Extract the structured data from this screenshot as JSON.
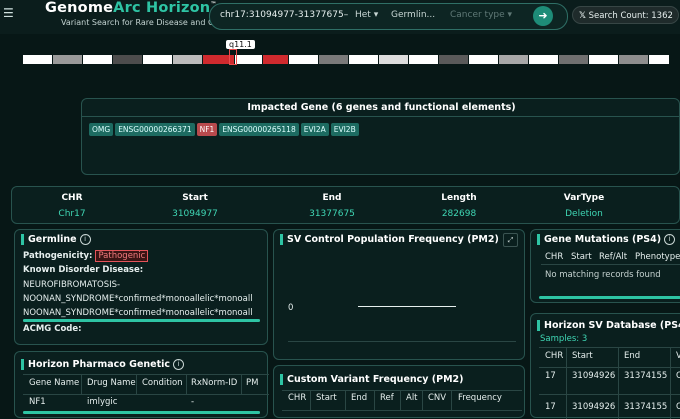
{
  "header": {
    "brand_prefix": "Genome",
    "brand_accent": "Arc Horizon",
    "brand_tm": "™",
    "subtitle": "Variant Search for Rare Disease and Cancer",
    "search_value": "chr17:31094977-31377675",
    "search_ellipsis": "–",
    "zygosity": "Het",
    "origin": "Germlin...",
    "cancer_placeholder": "Cancer type",
    "search_count": "Search Count: 1362",
    "accent_color": "#2ec4a4"
  },
  "ideogram": {
    "band_label": "q11.1"
  },
  "impacted": {
    "title": "Impacted Gene (6 genes and functional elements)",
    "chips": [
      {
        "text": "OMG",
        "type": "normal"
      },
      {
        "text": "ENSG00000266371",
        "type": "normal"
      },
      {
        "text": "NF1",
        "type": "red"
      },
      {
        "text": "ENSG00000265118",
        "type": "normal"
      },
      {
        "text": "EVI2A",
        "type": "normal"
      },
      {
        "text": "EVI2B",
        "type": "normal"
      }
    ]
  },
  "summary": {
    "chr_label": "CHR",
    "chr_value": "Chr17",
    "start_label": "Start",
    "start_value": "31094977",
    "end_label": "End",
    "end_value": "31377675",
    "length_label": "Length",
    "length_value": "282698",
    "vartype_label": "VarType",
    "vartype_value": "Deletion"
  },
  "germline": {
    "title": "Germline",
    "pathogenicity_label": "Pathogenicity:",
    "pathogenicity_value": "Pathogenic",
    "disorder_label": "Known Disorder Disease:",
    "disorder_line1": "NEUROFIBROMATOSIS-",
    "disorder_line2": "NOONAN_SYNDROME*confirmed*monoallelic*monoall",
    "disorder_line3": "NOONAN_SYNDROME*confirmed*monoallelic*monoall",
    "acmg_label": "ACMG Code:"
  },
  "sv_control": {
    "title": "SV Control Population Frequency (PM2)",
    "axis_zero": "0"
  },
  "gene_mutations": {
    "title": "Gene Mutations (PS4)",
    "columns": [
      "CHR",
      "Start",
      "Ref/Alt",
      "Phenotype"
    ],
    "empty": "No matching records found"
  },
  "pharmaco": {
    "title": "Horizon Pharmaco Genetic",
    "columns": [
      "Gene Name",
      "Drug Name",
      "Condition",
      "RxNorm-ID",
      "PM"
    ],
    "rows": [
      {
        "gene": "NF1",
        "drug": "imlygic",
        "condition": "",
        "rxnorm": "-",
        "pm": ""
      }
    ]
  },
  "custom_freq": {
    "title": "Custom Variant Frequency (PM2)",
    "columns": [
      "CHR",
      "Start",
      "End",
      "Ref",
      "Alt",
      "CNV",
      "Frequency"
    ]
  },
  "sv_database": {
    "title": "Horizon SV Database (PS4",
    "samples": "Samples: 3",
    "columns": [
      "CHR",
      "Start",
      "End",
      "V"
    ],
    "rows": [
      {
        "chr": "17",
        "start": "31094926",
        "end": "31374155",
        "v": "O"
      },
      {
        "chr": "17",
        "start": "31094926",
        "end": "31374155",
        "v": "O"
      }
    ]
  }
}
